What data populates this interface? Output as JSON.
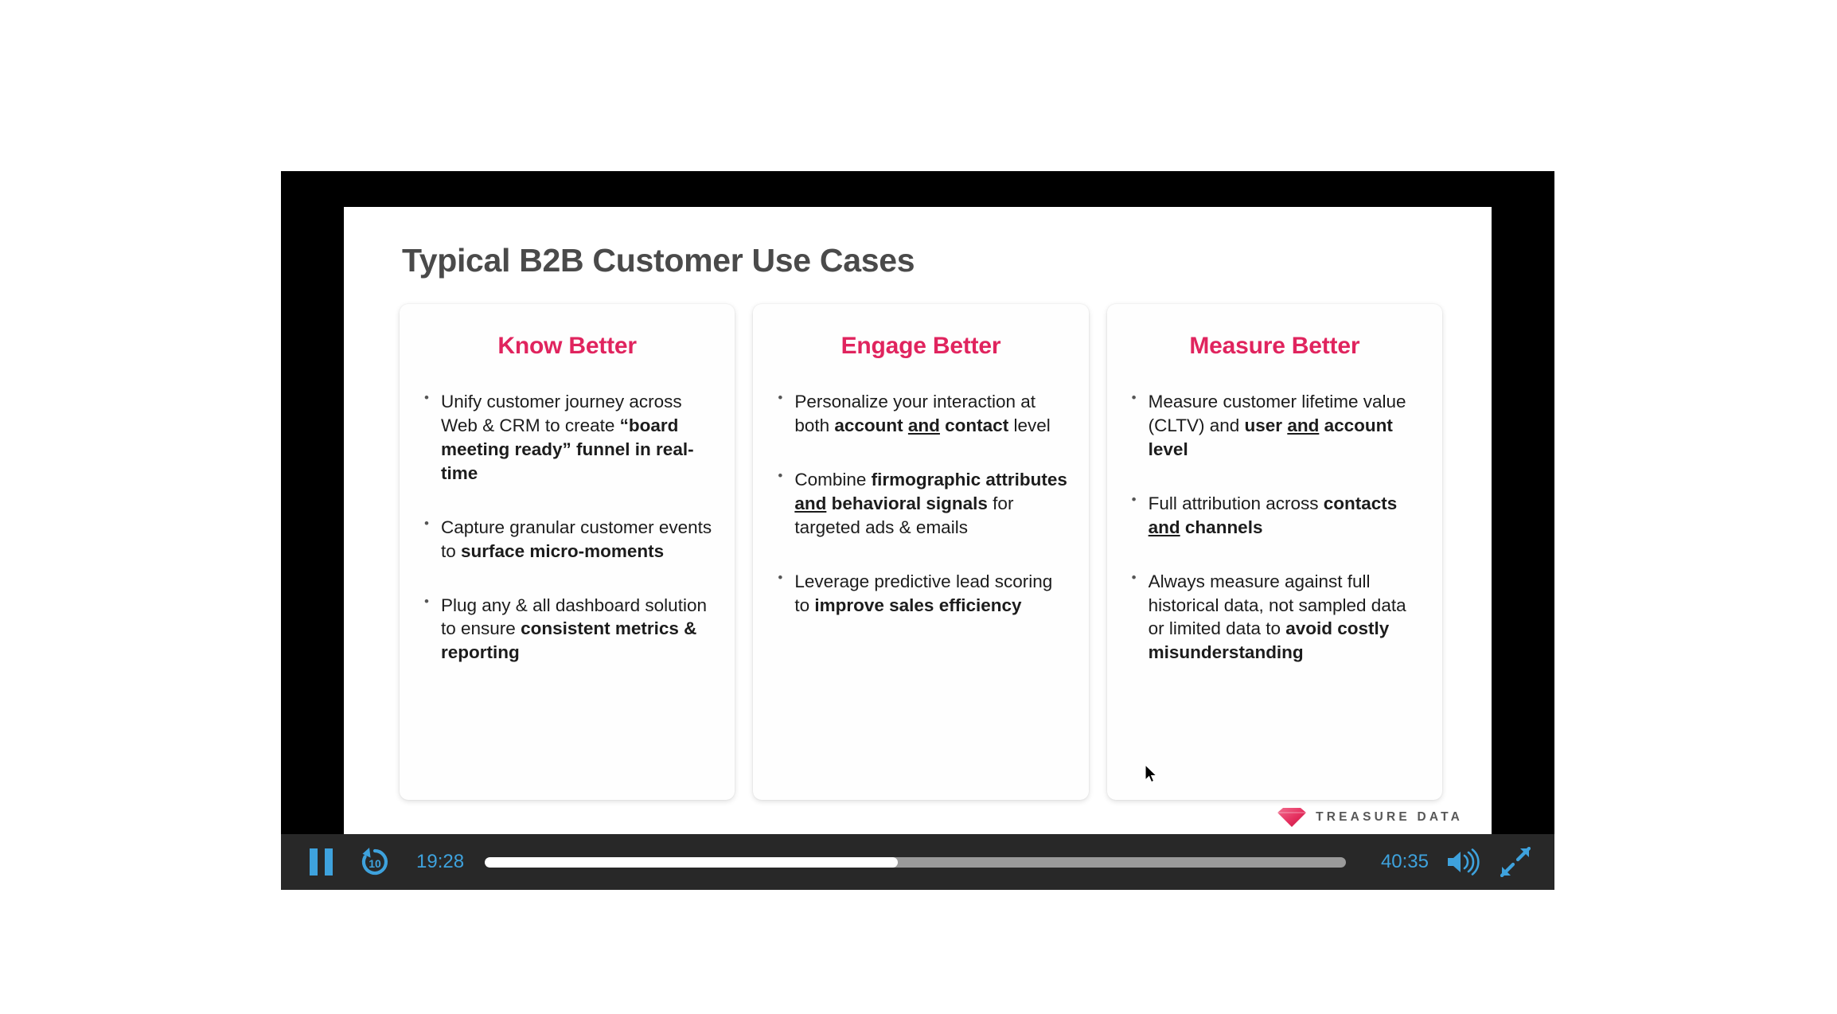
{
  "slide": {
    "title": "Typical B2B Customer Use Cases",
    "accent_color": "#e0245e",
    "title_color": "#4a4a4a",
    "columns": [
      {
        "heading": "Know Better",
        "bullets": [
          {
            "segments": [
              {
                "text": "Unify customer journey across Web & CRM to create ",
                "style": "normal"
              },
              {
                "text": "“board meeting ready” funnel in real-time",
                "style": "bold"
              }
            ]
          },
          {
            "segments": [
              {
                "text": "Capture granular customer events to ",
                "style": "normal"
              },
              {
                "text": "surface micro-moments",
                "style": "bold"
              }
            ]
          },
          {
            "segments": [
              {
                "text": "Plug any & all dashboard solution to ensure ",
                "style": "normal"
              },
              {
                "text": "consistent metrics & reporting",
                "style": "bold"
              }
            ]
          }
        ]
      },
      {
        "heading": "Engage Better",
        "bullets": [
          {
            "segments": [
              {
                "text": "Personalize your interaction at both ",
                "style": "normal"
              },
              {
                "text": "account ",
                "style": "bold"
              },
              {
                "text": "and",
                "style": "bold-underline"
              },
              {
                "text": " contact",
                "style": "bold"
              },
              {
                "text": " level",
                "style": "normal"
              }
            ]
          },
          {
            "segments": [
              {
                "text": "Combine ",
                "style": "normal"
              },
              {
                "text": "firmographic attributes ",
                "style": "bold"
              },
              {
                "text": "and",
                "style": "bold-underline"
              },
              {
                "text": " behavioral signals",
                "style": "bold"
              },
              {
                "text": " for targeted ads & emails",
                "style": "normal"
              }
            ]
          },
          {
            "segments": [
              {
                "text": "Leverage predictive lead scoring to ",
                "style": "normal"
              },
              {
                "text": "improve sales efficiency",
                "style": "bold"
              }
            ]
          }
        ]
      },
      {
        "heading": "Measure Better",
        "bullets": [
          {
            "segments": [
              {
                "text": "Measure customer lifetime value (CLTV) and ",
                "style": "normal"
              },
              {
                "text": "user ",
                "style": "bold"
              },
              {
                "text": "and",
                "style": "bold-underline"
              },
              {
                "text": " account level",
                "style": "bold"
              }
            ]
          },
          {
            "segments": [
              {
                "text": "Full attribution across ",
                "style": "normal"
              },
              {
                "text": "contacts ",
                "style": "bold"
              },
              {
                "text": "and",
                "style": "bold-underline"
              },
              {
                "text": " channels",
                "style": "bold"
              }
            ]
          },
          {
            "segments": [
              {
                "text": "Always measure against full historical data, not sampled data or limited data to ",
                "style": "normal"
              },
              {
                "text": "avoid costly misunderstanding",
                "style": "bold"
              }
            ]
          }
        ]
      }
    ],
    "logo": {
      "wordmark": "TREASURE DATA",
      "gem_color": "#e5305f",
      "icon": "diamond-gem-icon"
    }
  },
  "player": {
    "state": "playing",
    "pause_label": "Pause",
    "rewind_label": "10",
    "rewind_seconds": "10",
    "current_time": "19:28",
    "total_time": "40:35",
    "progress_percent": 48,
    "accent_color": "#3ea2dd",
    "bar_color": "#282828",
    "volume_label": "Volume",
    "fullscreen_label": "Fullscreen"
  }
}
